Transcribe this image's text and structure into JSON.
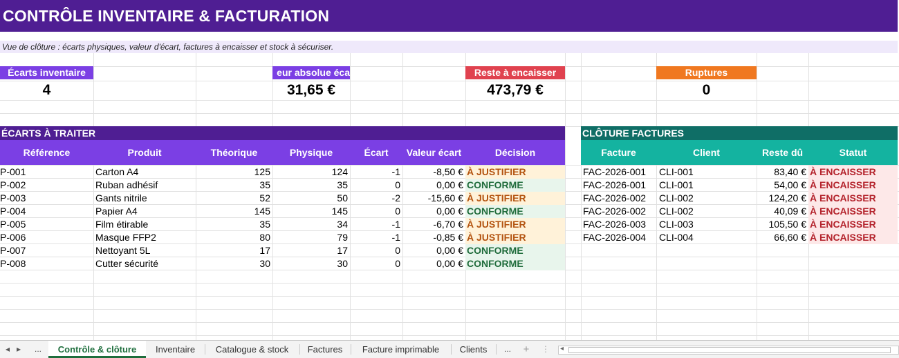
{
  "title": "CONTRÔLE INVENTAIRE & FACTURATION",
  "subtitle": "Vue de clôture : écarts physiques, valeur d'écart, factures à encaisser et stock à sécuriser.",
  "kpis": [
    {
      "label": "Écarts inventaire",
      "value": "4",
      "color": "#7b3fe4"
    },
    {
      "label": "eur absolue éca",
      "value": "31,65 €",
      "color": "#7b3fe4"
    },
    {
      "label": "Reste à encaisser",
      "value": "473,79 €",
      "color": "#e0424f"
    },
    {
      "label": "Ruptures",
      "value": "0",
      "color": "#f07820"
    }
  ],
  "ecarts": {
    "section_title": "ÉCARTS À TRAITER",
    "headers": [
      "Référence",
      "Produit",
      "Théorique",
      "Physique",
      "Écart",
      "Valeur écart",
      "Décision"
    ],
    "rows": [
      {
        "ref": "P-001",
        "produit": "Carton A4",
        "theorique": "125",
        "physique": "124",
        "ecart": "-1",
        "valeur": "-8,50 €",
        "decision": "À JUSTIFIER"
      },
      {
        "ref": "P-002",
        "produit": "Ruban adhésif",
        "theorique": "35",
        "physique": "35",
        "ecart": "0",
        "valeur": "0,00 €",
        "decision": "CONFORME"
      },
      {
        "ref": "P-003",
        "produit": "Gants nitrile",
        "theorique": "52",
        "physique": "50",
        "ecart": "-2",
        "valeur": "-15,60 €",
        "decision": "À JUSTIFIER"
      },
      {
        "ref": "P-004",
        "produit": "Papier A4",
        "theorique": "145",
        "physique": "145",
        "ecart": "0",
        "valeur": "0,00 €",
        "decision": "CONFORME"
      },
      {
        "ref": "P-005",
        "produit": "Film étirable",
        "theorique": "35",
        "physique": "34",
        "ecart": "-1",
        "valeur": "-6,70 €",
        "decision": "À JUSTIFIER"
      },
      {
        "ref": "P-006",
        "produit": "Masque FFP2",
        "theorique": "80",
        "physique": "79",
        "ecart": "-1",
        "valeur": "-0,85 €",
        "decision": "À JUSTIFIER"
      },
      {
        "ref": "P-007",
        "produit": "Nettoyant 5L",
        "theorique": "17",
        "physique": "17",
        "ecart": "0",
        "valeur": "0,00 €",
        "decision": "CONFORME"
      },
      {
        "ref": "P-008",
        "produit": "Cutter sécurité",
        "theorique": "30",
        "physique": "30",
        "ecart": "0",
        "valeur": "0,00 €",
        "decision": "CONFORME"
      }
    ]
  },
  "factures": {
    "section_title": "CLÔTURE FACTURES",
    "headers": [
      "Facture",
      "Client",
      "Reste dû",
      "Statut"
    ],
    "rows": [
      {
        "facture": "FAC-2026-001",
        "client": "CLI-001",
        "reste": "83,40 €",
        "statut": "À ENCAISSER"
      },
      {
        "facture": "FAC-2026-001",
        "client": "CLI-001",
        "reste": "54,00 €",
        "statut": "À ENCAISSER"
      },
      {
        "facture": "FAC-2026-002",
        "client": "CLI-002",
        "reste": "124,20 €",
        "statut": "À ENCAISSER"
      },
      {
        "facture": "FAC-2026-002",
        "client": "CLI-002",
        "reste": "40,09 €",
        "statut": "À ENCAISSER"
      },
      {
        "facture": "FAC-2026-003",
        "client": "CLI-003",
        "reste": "105,50 €",
        "statut": "À ENCAISSER"
      },
      {
        "facture": "FAC-2026-004",
        "client": "CLI-004",
        "reste": "66,60 €",
        "statut": "À ENCAISSER"
      }
    ]
  },
  "colors": {
    "title_bg": "#4f1e93",
    "table_header_purple": "#7b3fe4",
    "section_purple": "#4f1e93",
    "section_teal": "#0f6e66",
    "table_header_teal": "#14b3a0"
  },
  "sheet_tabs": {
    "nav_prev": "◂",
    "nav_next": "▸",
    "ellipsis_left": "...",
    "items": [
      "Contrôle & clôture",
      "Inventaire",
      "Catalogue & stock",
      "Factures",
      "Facture imprimable",
      "Clients"
    ],
    "active_index": 0,
    "ellipsis_right": "...",
    "add_sheet": "+",
    "more": "⋮",
    "scroll_left": "◂"
  }
}
